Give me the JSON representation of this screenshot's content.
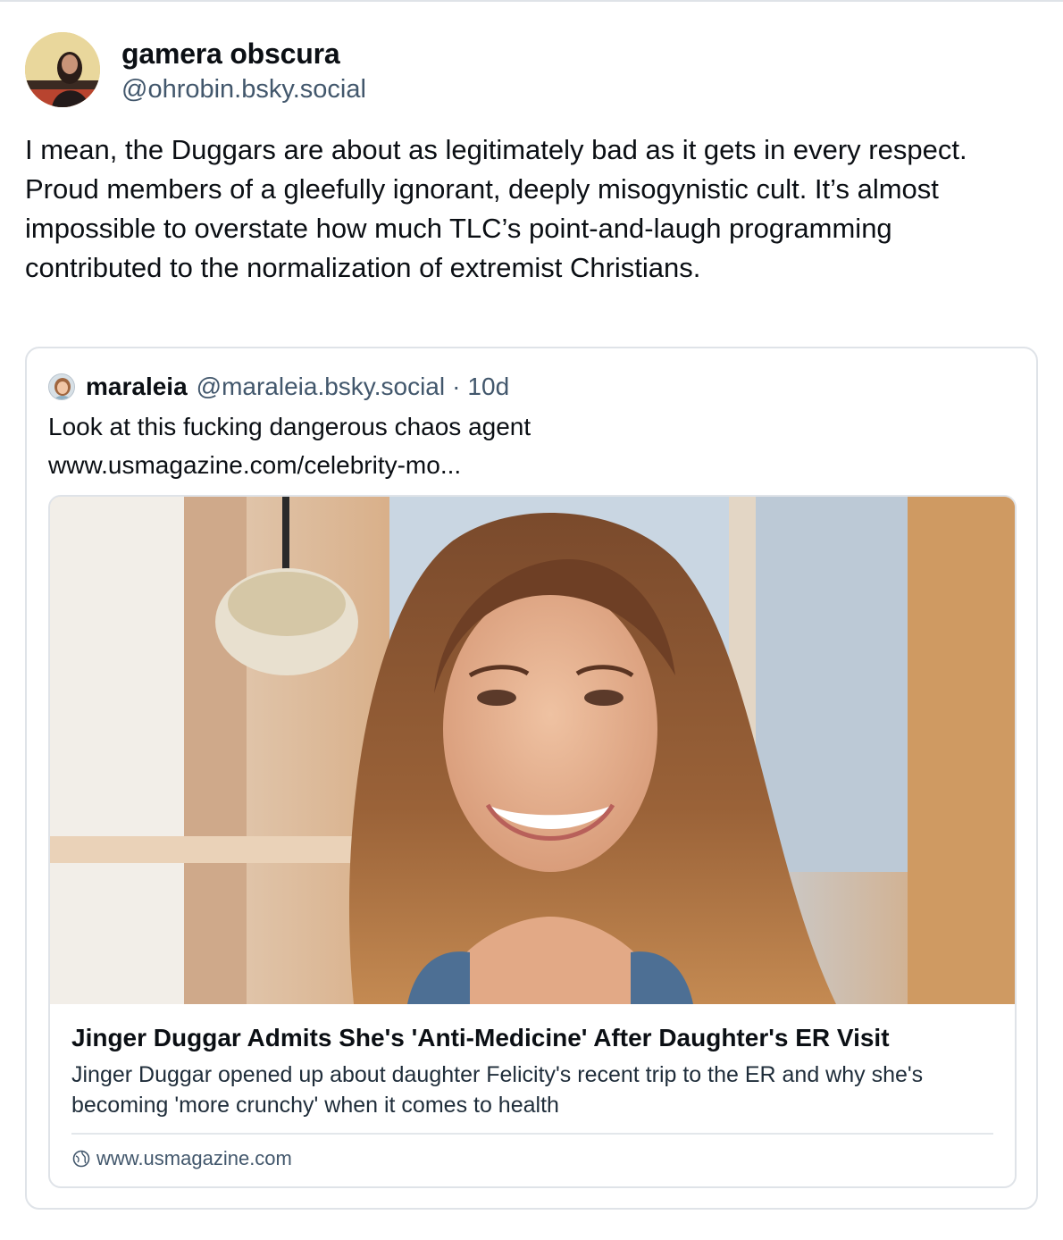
{
  "post": {
    "author": {
      "display_name": "gamera obscura",
      "handle": "@ohrobin.bsky.social"
    },
    "text": "I mean, the Duggars are about as legitimately bad as it gets in every respect. Proud members of a gleefully ignorant, deeply misogynistic cult. It’s almost impossible to overstate how much TLC’s point-and-laugh programming contributed to the normalization of extremist Christians."
  },
  "quote": {
    "author": {
      "display_name": "maraleia",
      "handle": "@maraleia.bsky.social",
      "separator": "·",
      "time": "10d"
    },
    "text_line1": "Look at this fucking dangerous chaos agent",
    "text_line2": "www.usmagazine.com/celebrity-mo...",
    "link_card": {
      "title": "Jinger Duggar Admits She's 'Anti-Medicine' After Daughter's ER Visit",
      "description": "Jinger Duggar opened up about daughter Felicity's recent trip to the ER and why she's becoming 'more crunchy' when it comes to health",
      "domain": "www.usmagazine.com",
      "icon": "globe-icon"
    }
  },
  "colors": {
    "text": "#0b0f14",
    "secondary_text": "#42576c",
    "border": "#dfe3e8"
  }
}
